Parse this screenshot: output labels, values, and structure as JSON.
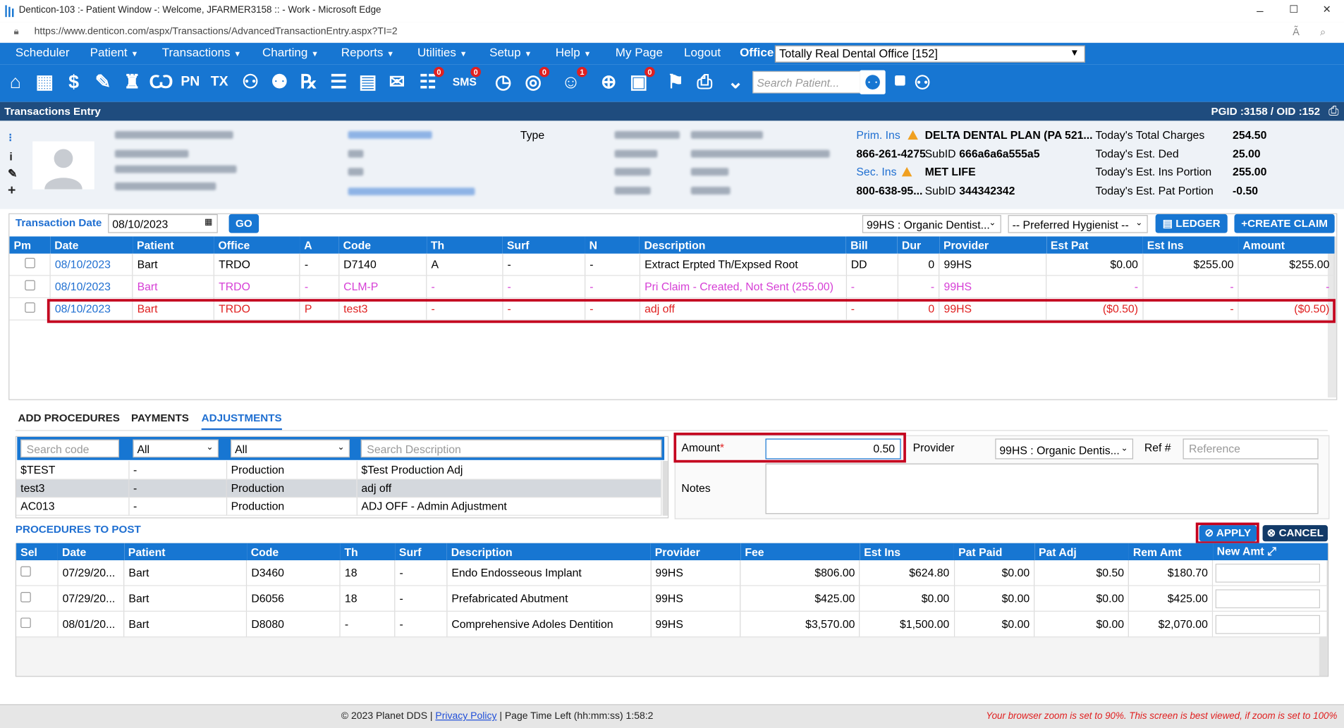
{
  "browser": {
    "title": "Denticon-103 :- Patient Window -: Welcome, JFARMER3158 :: - Work - Microsoft Edge",
    "url": "https://www.denticon.com/aspx/Transactions/AdvancedTransactionEntry.aspx?TI=2",
    "window_controls": {
      "minimize": "–",
      "maximize": "☐",
      "close": "✕"
    }
  },
  "menu": {
    "items": [
      "Scheduler",
      "Patient",
      "Transactions",
      "Charting",
      "Reports",
      "Utilities",
      "Setup",
      "Help",
      "My Page",
      "Logout"
    ],
    "office_label": "Office",
    "office_value": "Totally Real Dental Office [152]"
  },
  "toolbar": {
    "search_placeholder": "Search Patient...",
    "badges": {
      "sms": "0",
      "globe": "0",
      "smile": "1",
      "doc": "0",
      "chat": "0"
    }
  },
  "section": {
    "title": "Transactions Entry",
    "ids": "PGID :3158  /  OID :152"
  },
  "patient": {
    "type_label": "Type",
    "prim_ins_label": "Prim. Ins",
    "prim_ins_name": "DELTA DENTAL PLAN (PA 521...",
    "prim_ins_phone": "866-261-4275",
    "prim_subid_label": "SubID",
    "prim_subid": "666a6a6a555a5",
    "sec_ins_label": "Sec. Ins",
    "sec_ins_name": "MET LIFE",
    "sec_ins_phone": "800-638-95...",
    "sec_subid_label": "SubID",
    "sec_subid": "344342342",
    "totals": [
      {
        "label": "Today's Total Charges",
        "value": "254.50"
      },
      {
        "label": "Today's Est. Ded",
        "value": "25.00"
      },
      {
        "label": "Today's Est. Ins Portion",
        "value": "255.00"
      },
      {
        "label": "Today's Est. Pat Portion",
        "value": "-0.50"
      }
    ]
  },
  "txn_controls": {
    "date_label": "Transaction Date",
    "date_value": "08/10/2023",
    "go": "GO",
    "provider": "99HS : Organic Dentist...",
    "hygienist": "-- Preferred Hygienist --",
    "ledger": "LEDGER",
    "create_claim": "CREATE CLAIM"
  },
  "txn_table": {
    "headers": [
      "Pm",
      "Date",
      "Patient",
      "Office",
      "A",
      "Code",
      "Th",
      "Surf",
      "N",
      "Description",
      "Bill",
      "Dur",
      "Provider",
      "Est Pat",
      "Est Ins",
      "Amount"
    ],
    "rows": [
      {
        "date": "08/10/2023",
        "patient": "Bart",
        "office": "TRDO",
        "a": "-",
        "code": "D7140",
        "th": "A",
        "surf": "-",
        "n": "-",
        "desc": "Extract Erpted Th/Expsed Root",
        "bill": "DD",
        "dur": "0",
        "provider": "99HS",
        "estpat": "$0.00",
        "estins": "$255.00",
        "amount": "$255.00"
      },
      {
        "date": "08/10/2023",
        "patient": "Bart",
        "office": "TRDO",
        "a": "-",
        "code": "CLM-P",
        "th": "-",
        "surf": "-",
        "n": "-",
        "desc": "Pri Claim - Created, Not Sent (255.00)",
        "bill": "-",
        "dur": "-",
        "provider": "99HS",
        "estpat": "-",
        "estins": "-",
        "amount": "-"
      },
      {
        "date": "08/10/2023",
        "patient": "Bart",
        "office": "TRDO",
        "a": "P",
        "code": "test3",
        "th": "-",
        "surf": "-",
        "n": "-",
        "desc": "adj off",
        "bill": "-",
        "dur": "0",
        "provider": "99HS",
        "estpat": "($0.50)",
        "estins": "-",
        "amount": "($0.50)"
      }
    ]
  },
  "tabs": [
    "ADD PROCEDURES",
    "PAYMENTS",
    "ADJUSTMENTS"
  ],
  "adj_search": {
    "code_placeholder": "Search code",
    "filter1": "All",
    "filter2": "All",
    "desc_placeholder": "Search Description",
    "rows": [
      {
        "code": "$TEST",
        "x": "-",
        "type": "Production",
        "desc": "$Test Production Adj"
      },
      {
        "code": "test3",
        "x": "-",
        "type": "Production",
        "desc": "adj off"
      },
      {
        "code": "AC013",
        "x": "-",
        "type": "Production",
        "desc": "ADJ OFF - Admin Adjustment"
      }
    ]
  },
  "adj_form": {
    "amount_label": "Amount",
    "required_mark": "*",
    "amount_value": "0.50",
    "provider_label": "Provider",
    "provider_value": "99HS : Organic Dentis...",
    "ref_label": "Ref #",
    "ref_placeholder": "Reference",
    "notes_label": "Notes"
  },
  "post": {
    "title": "PROCEDURES TO POST",
    "apply": "APPLY",
    "cancel": "CANCEL",
    "headers": [
      "Sel",
      "Date",
      "Patient",
      "Code",
      "Th",
      "Surf",
      "Description",
      "Provider",
      "Fee",
      "Est Ins",
      "Pat Paid",
      "Pat Adj",
      "Rem Amt",
      "New Amt"
    ],
    "rows": [
      {
        "date": "07/29/20...",
        "patient": "Bart",
        "code": "D3460",
        "th": "18",
        "surf": "-",
        "desc": "Endo Endosseous Implant",
        "provider": "99HS",
        "fee": "$806.00",
        "estins": "$624.80",
        "patpaid": "$0.00",
        "patadj": "$0.50",
        "rem": "$180.70"
      },
      {
        "date": "07/29/20...",
        "patient": "Bart",
        "code": "D6056",
        "th": "18",
        "surf": "-",
        "desc": "Prefabricated Abutment",
        "provider": "99HS",
        "fee": "$425.00",
        "estins": "$0.00",
        "patpaid": "$0.00",
        "patadj": "$0.00",
        "rem": "$425.00"
      },
      {
        "date": "08/01/20...",
        "patient": "Bart",
        "code": "D8080",
        "th": "-",
        "surf": "-",
        "desc": "Comprehensive Adoles Dentition",
        "provider": "99HS",
        "fee": "$3,570.00",
        "estins": "$1,500.00",
        "patpaid": "$0.00",
        "patadj": "$0.00",
        "rem": "$2,070.00"
      }
    ]
  },
  "footer": {
    "copyright": "© 2023 Planet DDS |",
    "privacy": "Privacy Policy",
    "time_left": "| Page Time Left (hh:mm:ss) 1:58:2",
    "zoom_msg": "Your browser zoom is set to 90%. This screen is best viewed, if zoom is set to 100%"
  },
  "colors": {
    "brand_blue": "#1776d2",
    "dark_blue": "#1f4c7e",
    "highlight": "#c4001e",
    "claim_pink": "#d63fd6",
    "negative_red": "#e02020"
  }
}
